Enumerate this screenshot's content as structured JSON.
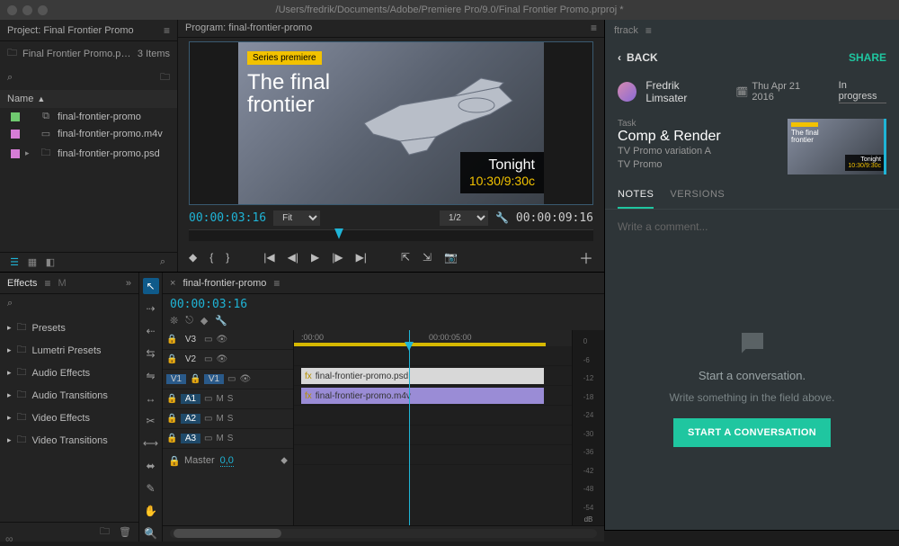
{
  "titlebar": "/Users/fredrik/Documents/Adobe/Premiere Pro/9.0/Final Frontier Promo.prproj *",
  "project": {
    "panel_title": "Project: Final Frontier Promo",
    "file": "Final Frontier Promo.prproj",
    "items_count": "3 Items",
    "col_header": "Name",
    "items": [
      {
        "label": "final-frontier-promo",
        "type": "sequence"
      },
      {
        "label": "final-frontier-promo.m4v",
        "type": "video"
      },
      {
        "label": "final-frontier-promo.psd",
        "type": "bin"
      }
    ]
  },
  "program": {
    "panel_title": "Program: final-frontier-promo",
    "badge": "Series premiere",
    "overlay_l1": "The final",
    "overlay_l2": "frontier",
    "tonight": "Tonight",
    "time": "10:30/9:30c",
    "tc_left": "00:00:03:16",
    "fit": "Fit",
    "half": "1/2",
    "tc_right": "00:00:09:16"
  },
  "effects": {
    "title": "Effects",
    "other_tab": "M",
    "items": [
      "Presets",
      "Lumetri Presets",
      "Audio Effects",
      "Audio Transitions",
      "Video Effects",
      "Video Transitions"
    ]
  },
  "timeline": {
    "seq_name": "final-frontier-promo",
    "tc": "00:00:03:16",
    "ruler": {
      "t0": ":00:00",
      "t1": "00:00:05:00"
    },
    "tracks": {
      "v3": "V3",
      "v2": "V2",
      "v1": "V1",
      "a1": "A1",
      "a2": "A2",
      "a3": "A3",
      "master": "Master",
      "master_val": "0,0"
    },
    "clips": {
      "psd": "final-frontier-promo.psd",
      "m4v": "final-frontier-promo.m4v"
    },
    "meters": [
      "0",
      "-6",
      "-12",
      "-18",
      "-24",
      "-30",
      "-36",
      "-42",
      "-48",
      "-54"
    ],
    "db": "dB"
  },
  "ftrack": {
    "brand": "ftrack",
    "back": "BACK",
    "share": "SHARE",
    "user": "Fredrik Limsater",
    "date": "Thu Apr 21 2016",
    "status": "In progress",
    "task_label": "Task",
    "task_name": "Comp & Render",
    "task_sub1": "TV Promo variation A",
    "task_sub2": "TV Promo",
    "thumb": {
      "title_l1": "The final",
      "title_l2": "frontier",
      "tonight": "Tonight",
      "time": "10:30/9:30c"
    },
    "tabs": {
      "notes": "NOTES",
      "versions": "VERSIONS"
    },
    "comment_placeholder": "Write a comment...",
    "empty_title": "Start a conversation.",
    "empty_sub": "Write something in the field above.",
    "cta": "START A CONVERSATION"
  }
}
